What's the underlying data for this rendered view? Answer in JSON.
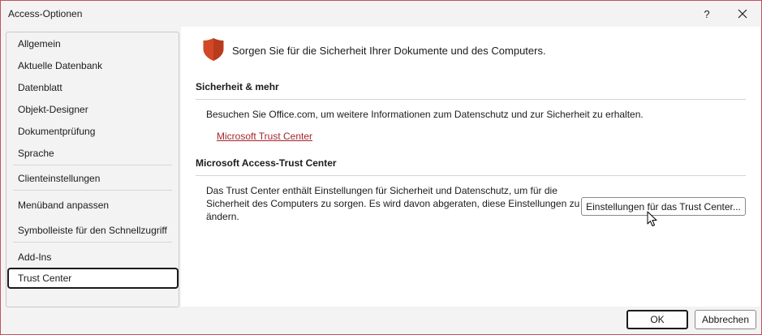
{
  "window": {
    "title": "Access-Optionen",
    "help_glyph": "?",
    "close_glyph": "✕"
  },
  "sidebar": {
    "items": [
      {
        "label": "Allgemein"
      },
      {
        "label": "Aktuelle Datenbank"
      },
      {
        "label": "Datenblatt"
      },
      {
        "label": "Objekt-Designer"
      },
      {
        "label": "Dokumentprüfung"
      },
      {
        "label": "Sprache"
      },
      {
        "label": "Clienteinstellungen"
      },
      {
        "label": "Menüband anpassen"
      },
      {
        "label": "Symbolleiste für den Schnellzugriff"
      },
      {
        "label": "Add-Ins"
      },
      {
        "label": "Trust Center",
        "selected": true
      }
    ]
  },
  "main": {
    "headline": "Sorgen Sie für die Sicherheit Ihrer Dokumente und des Computers.",
    "section1": {
      "title": "Sicherheit & mehr",
      "text": "Besuchen Sie Office.com, um weitere Informationen zum Datenschutz und zur Sicherheit zu erhalten.",
      "link": "Microsoft Trust Center"
    },
    "section2": {
      "title": "Microsoft Access-Trust Center",
      "text_line1": "Das Trust Center enthält Einstellungen für Sicherheit und Datenschutz, um für die",
      "text_line2": "Sicherheit des Computers zu sorgen. Es wird davon abgeraten, diese Einstellungen zu",
      "text_line3": "ändern.",
      "button": "Einstellungen für das Trust Center..."
    }
  },
  "footer": {
    "ok": "OK",
    "cancel": "Abbrechen"
  },
  "colors": {
    "shield": "#d24726",
    "link": "#a4262c",
    "window_border": "#c4505e"
  }
}
